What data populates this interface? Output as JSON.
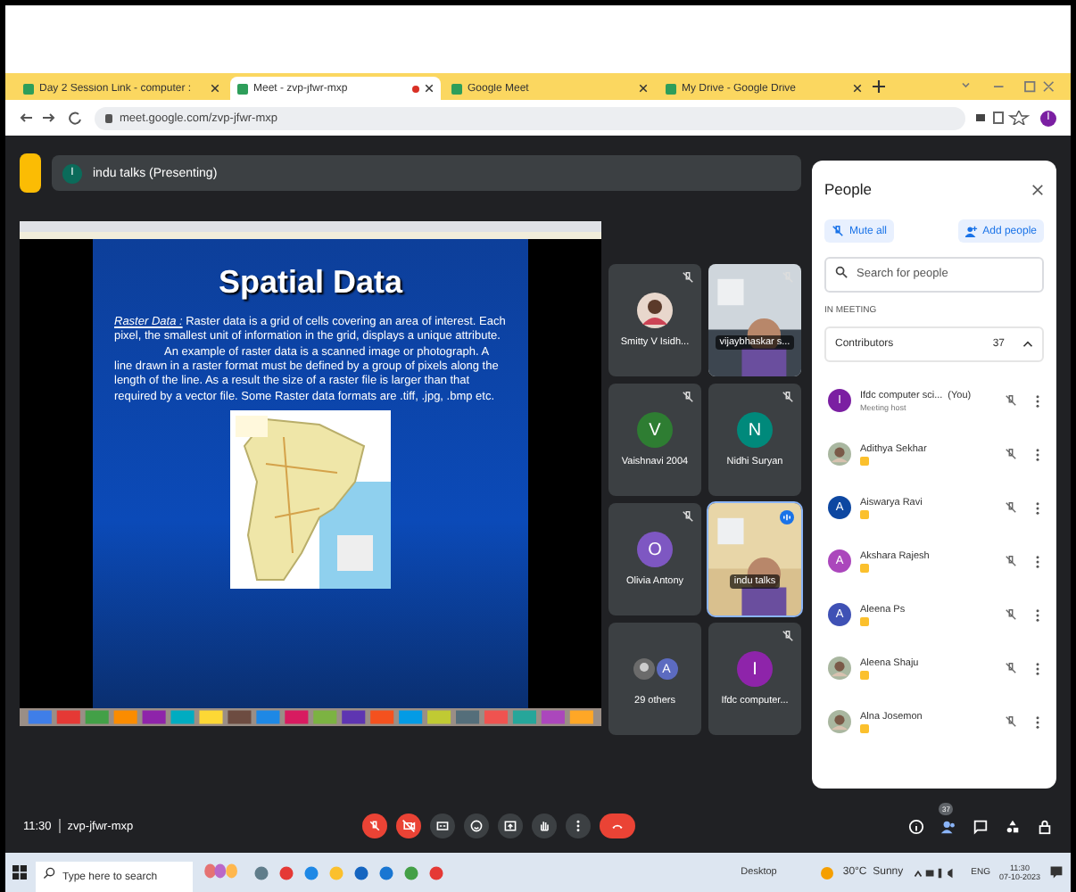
{
  "browser": {
    "tabs": [
      {
        "title": "Day 2 Session Link - computer :",
        "selected": false,
        "recording": false
      },
      {
        "title": "Meet - zvp-jfwr-mxp",
        "selected": true,
        "recording": true
      },
      {
        "title": "Google Meet",
        "selected": false,
        "recording": false
      },
      {
        "title": "My Drive - Google Drive",
        "selected": false,
        "recording": false
      }
    ],
    "url": "meet.google.com/zvp-jfwr-mxp",
    "profile_letter": "I"
  },
  "meet": {
    "presenter": {
      "letter": "I",
      "label": "indu talks (Presenting)"
    },
    "slide": {
      "title": "Spatial Data",
      "term": "Raster Data :",
      "definition": " Raster data is a grid of cells covering an area of interest. Each pixel, the smallest unit of information in the grid, displays a unique attribute.",
      "paragraph": "An example of raster data is a scanned image or photograph. A line drawn in a raster format must be defined by a group of pixels along the length of the line. As a result the size of a raster file is larger than that required by a vector file. Some Raster data formats are .tiff, .jpg, .bmp etc."
    },
    "tiles": [
      {
        "name": "Smitty V Isidh...",
        "muted": true,
        "speaking": false
      },
      {
        "kind": "video",
        "name": "vijaybhaskar s...",
        "muted": true,
        "speaking": false
      },
      {
        "kind": "letter",
        "name": "Vaishnavi 2004",
        "letter": "V",
        "color": "#2e7d32",
        "muted": true,
        "speaking": false
      },
      {
        "kind": "letter",
        "name": "Nidhi Suryan",
        "letter": "N",
        "color": "#00897b",
        "muted": true,
        "speaking": false
      },
      {
        "kind": "letter",
        "name": "Olivia Antony",
        "letter": "O",
        "color": "#7e57c2",
        "muted": true,
        "speaking": false
      },
      {
        "kind": "video",
        "name": "indu talks",
        "muted": false,
        "speaking": true
      },
      {
        "kind": "others",
        "name": "29 others",
        "letter": "A",
        "color": "#5c6bc0",
        "muted": false,
        "speaking": false
      },
      {
        "kind": "letter",
        "name": "Ifdc computer...",
        "letter": "I",
        "color": "#8e24aa",
        "muted": true,
        "speaking": false
      }
    ],
    "people": {
      "title": "People",
      "buttons": [
        "Mute all",
        "Add people"
      ],
      "search": {
        "placeholder": "Search for people"
      },
      "section": "IN MEETING",
      "group": {
        "name": "Contributors",
        "count": "37",
        "expanded": true
      },
      "members": [
        {
          "kind": "letter",
          "letter": "I",
          "color": "#7b1fa2",
          "name": "Ifdc computer sci...",
          "you": "(You)",
          "role": "Meeting host",
          "tagged": false
        },
        {
          "name": "Adithya Sekhar",
          "tagged": true
        },
        {
          "kind": "letter",
          "letter": "A",
          "color": "#0d47a1",
          "name": "Aiswarya Ravi",
          "tagged": true
        },
        {
          "kind": "letter",
          "letter": "A",
          "color": "#ab47bc",
          "name": "Akshara Rajesh",
          "tagged": true
        },
        {
          "kind": "letter",
          "letter": "A",
          "color": "#3f51b5",
          "name": "Aleena Ps",
          "tagged": true
        },
        {
          "name": "Aleena Shaju",
          "tagged": true
        },
        {
          "name": "Alna Josemon",
          "tagged": true
        }
      ]
    },
    "bottom": {
      "time": "11:30",
      "code": "zvp-jfwr-mxp",
      "controls": [
        {
          "kind": "mic",
          "off": true
        },
        {
          "kind": "camera",
          "off": true
        },
        {
          "kind": "captions",
          "off": false
        },
        {
          "kind": "emoji",
          "off": false
        },
        {
          "kind": "present",
          "off": false
        },
        {
          "kind": "hand",
          "off": false
        },
        {
          "kind": "more",
          "off": false
        },
        {
          "kind": "leave",
          "off": true
        }
      ],
      "people_count": "37"
    }
  },
  "taskbar": {
    "search": {
      "placeholder": "Type here to search"
    },
    "desktop": "Desktop",
    "weather": "30°C  Sunny",
    "lang": "ENG",
    "time": "11:30",
    "date": "07-10-2023"
  }
}
